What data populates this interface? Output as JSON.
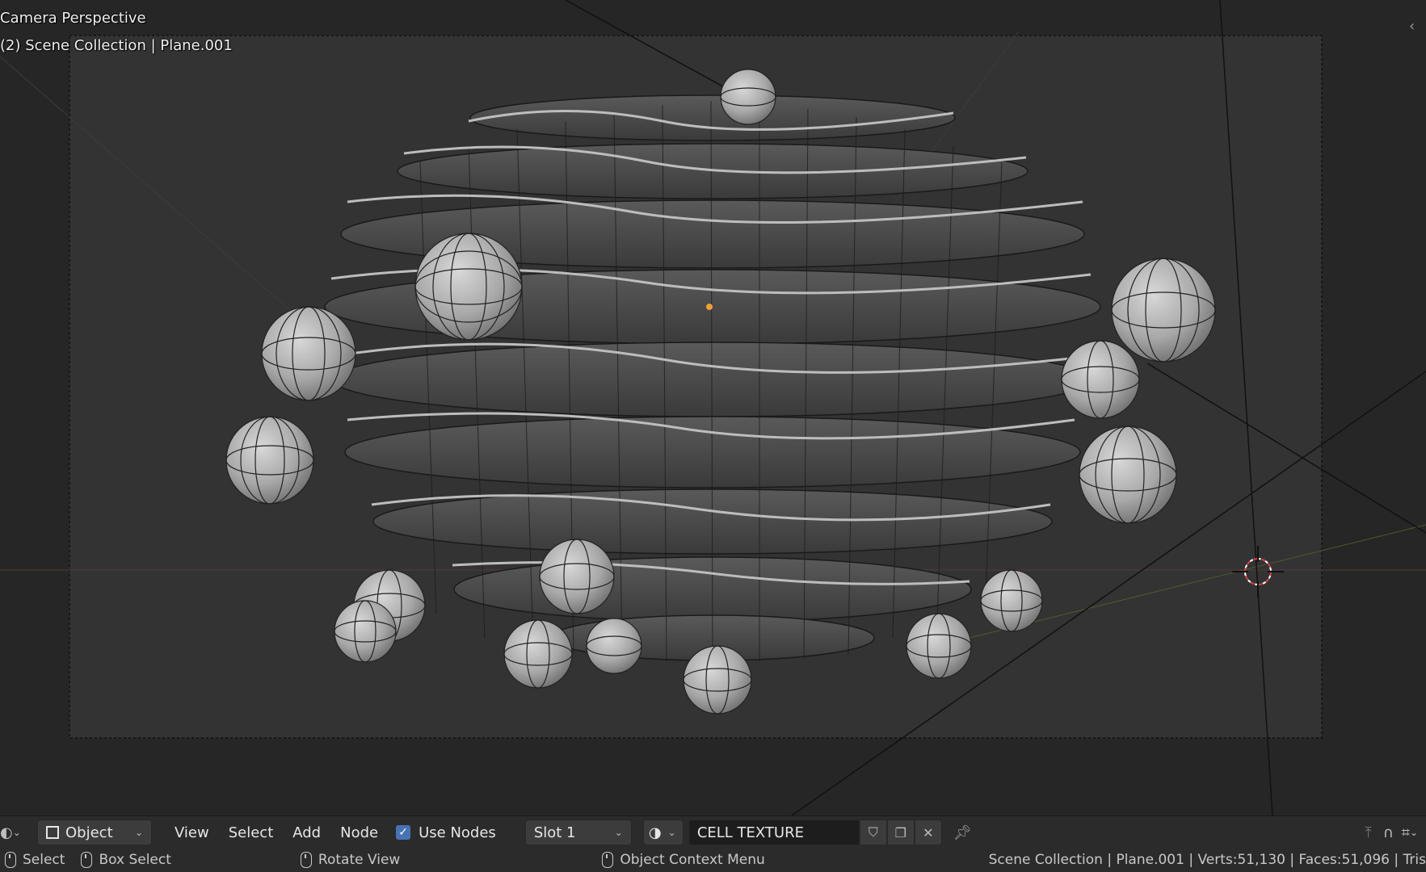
{
  "viewport": {
    "view_name": "Camera Perspective",
    "collection_label": "(2) Scene Collection | Plane.001"
  },
  "header": {
    "mode_label": "Object",
    "menus": [
      "View",
      "Select",
      "Add",
      "Node"
    ],
    "use_nodes_label": "Use Nodes",
    "use_nodes_checked": true,
    "slot_label": "Slot 1",
    "material_name": "CELL TEXTURE"
  },
  "status": {
    "select_label": "Select",
    "box_select_label": "Box Select",
    "rotate_view_label": "Rotate View",
    "context_menu_label": "Object Context Menu",
    "scene_stats": "Scene Collection | Plane.001 | Verts:51,130 | Faces:51,096 | Tris"
  },
  "colors": {
    "viewport_bg": "#262626",
    "header_bg": "#2b2b2b",
    "accent_blue": "#4772b3",
    "origin_orange": "#f0a030",
    "cursor_red": "#e04040"
  }
}
